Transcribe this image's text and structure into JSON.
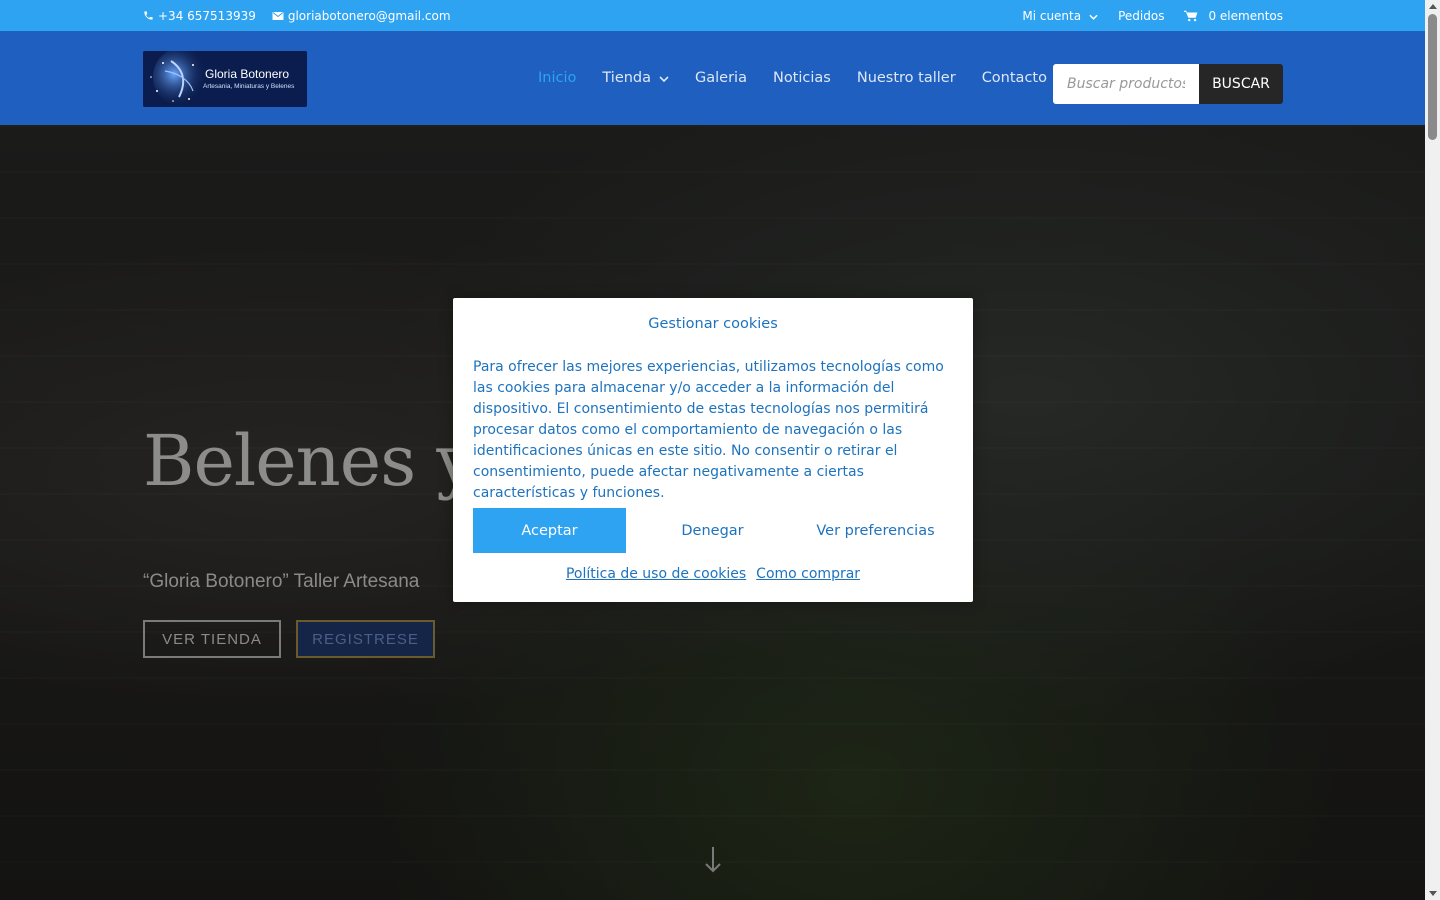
{
  "topbar": {
    "phone": "+34 657513939",
    "email": "gloriabotonero@gmail.com",
    "account": "Mi cuenta",
    "orders": "Pedidos",
    "cart": "0 elementos"
  },
  "header": {
    "logo_name": "Gloria Botonero",
    "logo_tagline": "Artesania, Miniaturas y Belenes",
    "nav": [
      "Inicio",
      "Tienda",
      "Galeria",
      "Noticias",
      "Nuestro taller",
      "Contacto"
    ],
    "search_placeholder": "Buscar productos…",
    "search_button": "BUSCAR"
  },
  "hero": {
    "title": "Belenes y",
    "subtitle": "“Gloria Botonero” Taller Artesana",
    "btn_shop": "VER TIENDA",
    "btn_register": "REGISTRESE"
  },
  "cookies": {
    "title": "Gestionar cookies",
    "body": "Para ofrecer las mejores experiencias, utilizamos tecnologías como las cookies para almacenar y/o acceder a la información del dispositivo. El consentimiento de estas tecnologías nos permitirá procesar datos como el comportamiento de navegación o las identificaciones únicas en este sitio. No consentir o retirar el consentimiento, puede afectar negativamente a ciertas características y funciones.",
    "accept": "Aceptar",
    "deny": "Denegar",
    "preferences": "Ver preferencias",
    "link_policy": "Política de uso de cookies",
    "link_buy": "Como comprar"
  },
  "colors": {
    "topbar": "#2ea3f2",
    "header": "#1e5fbf",
    "active_link": "#2ea3f2",
    "modal_text": "#1e73be"
  },
  "icons": [
    "phone-icon",
    "email-icon",
    "cart-icon",
    "chevron-down-icon",
    "arrow-down-icon"
  ]
}
